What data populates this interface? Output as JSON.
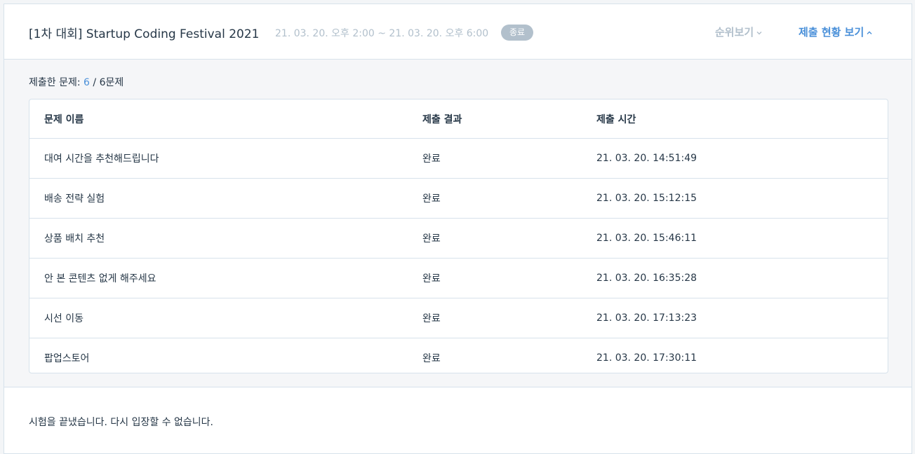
{
  "header": {
    "title": "[1차 대회] Startup Coding Festival 2021",
    "period": "21. 03. 20. 오후 2:00 ~ 21. 03. 20. 오후 6:00",
    "status_badge": "종료",
    "ranking_label": "순위보기",
    "submission_label": "제출 현황 보기"
  },
  "summary": {
    "prefix": "제출한 문제: ",
    "submitted": "6",
    "suffix": " / 6문제"
  },
  "table": {
    "columns": [
      "문제 이름",
      "제출 결과",
      "제출 시간"
    ],
    "rows": [
      {
        "name": "대여 시간을 추천해드립니다",
        "result": "완료",
        "time": "21. 03. 20. 14:51:49"
      },
      {
        "name": "배송 전략 실험",
        "result": "완료",
        "time": "21. 03. 20. 15:12:15"
      },
      {
        "name": "상품 배치 추천",
        "result": "완료",
        "time": "21. 03. 20. 15:46:11"
      },
      {
        "name": "안 본 콘텐츠 없게 해주세요",
        "result": "완료",
        "time": "21. 03. 20. 16:35:28"
      },
      {
        "name": "시선 이동",
        "result": "완료",
        "time": "21. 03. 20. 17:13:23"
      },
      {
        "name": "팝업스토어",
        "result": "완료",
        "time": "21. 03. 20. 17:30:11"
      }
    ]
  },
  "footer": {
    "message": "시험을 끝냈습니다. 다시 입장할 수 없습니다."
  },
  "colors": {
    "accent": "#4a90d9",
    "muted": "#b2c0cc",
    "text": "#263747",
    "border": "#d7e2eb"
  }
}
